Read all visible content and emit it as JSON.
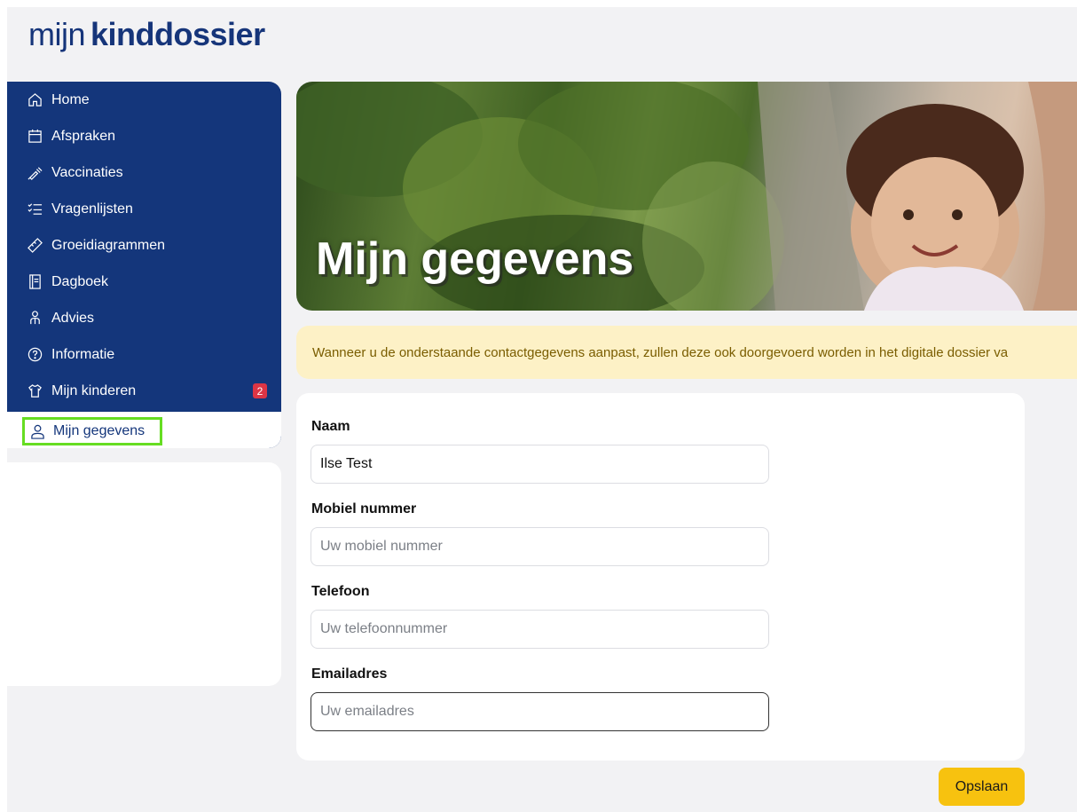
{
  "logo": {
    "light": "mijn",
    "bold": "kinddossier"
  },
  "sidebar": {
    "items": [
      {
        "label": "Home",
        "icon": "home-icon"
      },
      {
        "label": "Afspraken",
        "icon": "calendar-icon"
      },
      {
        "label": "Vaccinaties",
        "icon": "syringe-icon"
      },
      {
        "label": "Vragenlijsten",
        "icon": "checklist-icon"
      },
      {
        "label": "Groeidiagrammen",
        "icon": "ruler-icon"
      },
      {
        "label": "Dagboek",
        "icon": "notebook-icon"
      },
      {
        "label": "Advies",
        "icon": "people-icon"
      },
      {
        "label": "Informatie",
        "icon": "question-circle-icon"
      },
      {
        "label": "Mijn kinderen",
        "icon": "shirt-icon",
        "badge": "2"
      },
      {
        "label": "Mijn gegevens",
        "icon": "user-icon",
        "active": true
      }
    ]
  },
  "hero": {
    "title": "Mijn gegevens"
  },
  "notice": {
    "text": "Wanneer u de onderstaande contactgegevens aanpast, zullen deze ook doorgevoerd worden in het digitale dossier va"
  },
  "form": {
    "name": {
      "label": "Naam",
      "value": "Ilse Test",
      "placeholder": ""
    },
    "mobile": {
      "label": "Mobiel nummer",
      "value": "",
      "placeholder": "Uw mobiel nummer"
    },
    "phone": {
      "label": "Telefoon",
      "value": "",
      "placeholder": "Uw telefoonnummer"
    },
    "email": {
      "label": "Emailadres",
      "value": "",
      "placeholder": "Uw emailadres"
    }
  },
  "actions": {
    "save_label": "Opslaan"
  },
  "colors": {
    "brand_navy": "#14367b",
    "accent_yellow": "#f7c20f",
    "notice_bg": "#fdf1c6",
    "badge_red": "#dc3545",
    "focus_green": "#66dd22"
  }
}
